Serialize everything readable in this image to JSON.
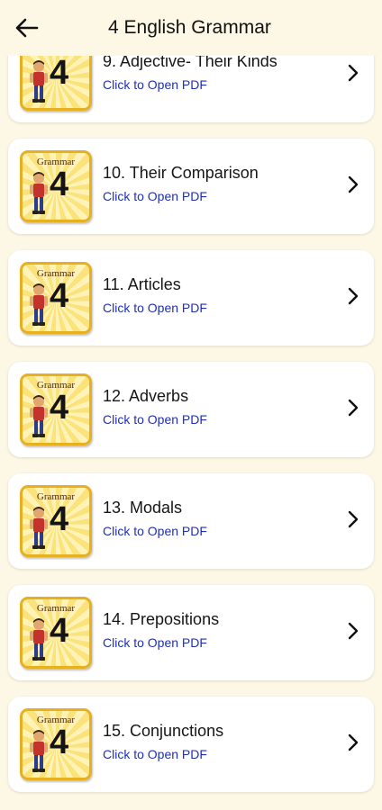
{
  "appbar": {
    "title": "4 English Grammar",
    "back_icon": "arrow-left-icon"
  },
  "thumbnail": {
    "label": "Grammar",
    "number": "4",
    "icon": "boy-illustration-icon"
  },
  "colors": {
    "background": "#fdf8e6",
    "subtitle": "#1f2fb8",
    "thumb_border": "#e6b020"
  },
  "items": [
    {
      "title": "9. Adjective- Their Kinds",
      "subtitle": "Click to Open PDF"
    },
    {
      "title": "10. Their Comparison",
      "subtitle": "Click to Open PDF"
    },
    {
      "title": "11. Articles",
      "subtitle": "Click to Open PDF"
    },
    {
      "title": "12. Adverbs",
      "subtitle": "Click to Open PDF"
    },
    {
      "title": "13. Modals",
      "subtitle": "Click to Open PDF"
    },
    {
      "title": "14. Prepositions",
      "subtitle": "Click to Open PDF"
    },
    {
      "title": "15. Conjunctions",
      "subtitle": "Click to Open PDF"
    }
  ]
}
